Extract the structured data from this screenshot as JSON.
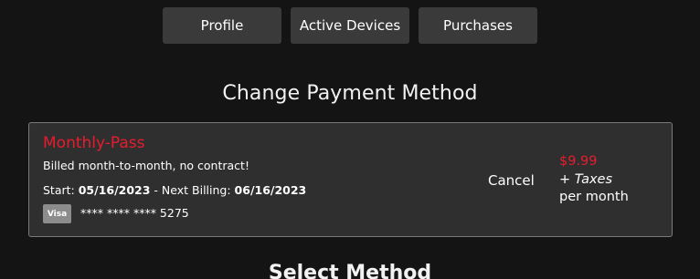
{
  "tabs": [
    {
      "label": "Profile"
    },
    {
      "label": "Active Devices"
    },
    {
      "label": "Purchases"
    }
  ],
  "page_title": "Change Payment Method",
  "plan": {
    "name": "Monthly-Pass",
    "billing_note": "Billed month-to-month, no contract!",
    "start_label": "Start:",
    "start_date": "05/16/2023",
    "separator": " - ",
    "next_billing_label": "Next Billing:",
    "next_billing_date": "06/16/2023",
    "card_brand": "Visa",
    "card_number": "**** **** **** 5275",
    "cancel_label": "Cancel",
    "price": "$9.99",
    "taxes_label": "+ Taxes",
    "period_label": "per month"
  },
  "next_section_title": "Select Method",
  "colors": {
    "background": "#141414",
    "card_background": "#2f2f2f",
    "accent_red": "#e81c2f",
    "tab_background": "#3a3a3a"
  }
}
